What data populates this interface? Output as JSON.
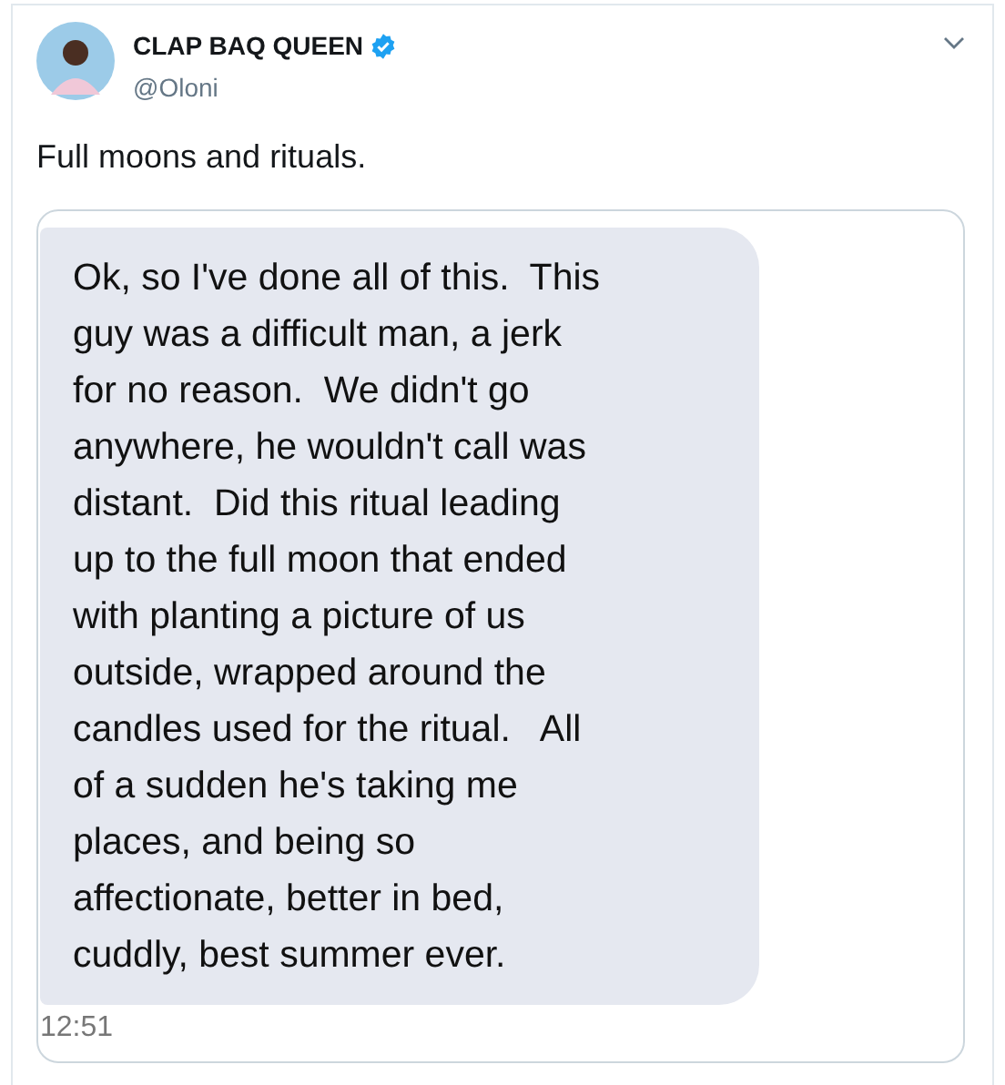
{
  "author": {
    "name": "CLAP BAQ QUEEN",
    "verified": true,
    "handle": "@Oloni"
  },
  "tweet_text": "Full moons and rituals.",
  "attached_screenshot": {
    "message_lines": [
      "Ok, so I've done all of this.  This",
      "guy was a difficult man, a jerk",
      "for no reason.  We didn't go",
      "anywhere, he wouldn't call was",
      "distant.  Did this ritual leading",
      "up to the full moon that ended",
      "with planting a picture of us",
      "outside, wrapped around the",
      "candles used for the ritual.   All",
      "of a sudden he's taking me",
      "places, and being so",
      "affectionate, better in bed,",
      "cuddly, best summer ever."
    ],
    "time": "12:51"
  }
}
